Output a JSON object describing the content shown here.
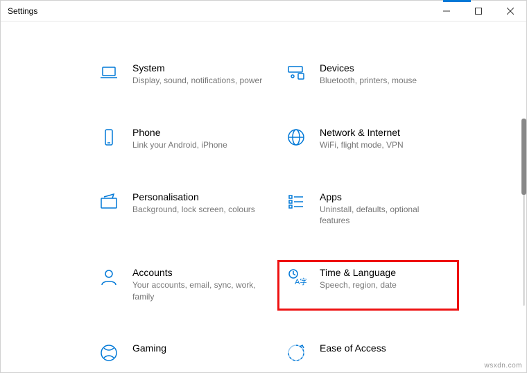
{
  "window": {
    "title": "Settings"
  },
  "categories": [
    {
      "key": "system",
      "icon": "laptop-icon",
      "title": "System",
      "desc": "Display, sound, notifications, power"
    },
    {
      "key": "devices",
      "icon": "devices-icon",
      "title": "Devices",
      "desc": "Bluetooth, printers, mouse"
    },
    {
      "key": "phone",
      "icon": "phone-icon",
      "title": "Phone",
      "desc": "Link your Android, iPhone"
    },
    {
      "key": "network",
      "icon": "globe-icon",
      "title": "Network & Internet",
      "desc": "WiFi, flight mode, VPN"
    },
    {
      "key": "personalisation",
      "icon": "paintbrush-icon",
      "title": "Personalisation",
      "desc": "Background, lock screen, colours"
    },
    {
      "key": "apps",
      "icon": "apps-list-icon",
      "title": "Apps",
      "desc": "Uninstall, defaults, optional features"
    },
    {
      "key": "accounts",
      "icon": "person-icon",
      "title": "Accounts",
      "desc": "Your accounts, email, sync, work, family"
    },
    {
      "key": "time-language",
      "icon": "time-lang-icon",
      "title": "Time & Language",
      "desc": "Speech, region, date",
      "highlight": true
    },
    {
      "key": "gaming",
      "icon": "xbox-icon",
      "title": "Gaming",
      "desc": ""
    },
    {
      "key": "ease-of-access",
      "icon": "ease-icon",
      "title": "Ease of Access",
      "desc": ""
    }
  ],
  "watermark": "wsxdn.com"
}
